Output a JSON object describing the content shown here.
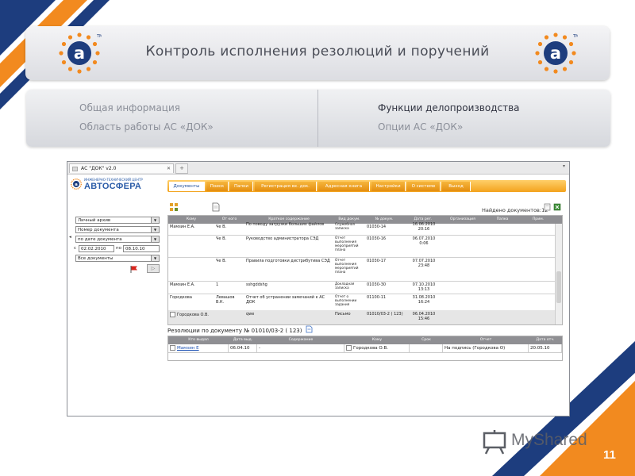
{
  "slide": {
    "title": "Контроль исполнения резолюций и поручений",
    "page_number": "11",
    "colors": {
      "orange": "#f28a1f",
      "navy": "#1d3d7e",
      "accent_blue": "#2b5ca8"
    }
  },
  "info_panel": {
    "left": [
      "Общая информация",
      "Область работы АС «ДОК»"
    ],
    "right": [
      "Функции делопроизводства",
      "Опции АС «ДОК»"
    ]
  },
  "browser": {
    "tab_title": "АС \"ДОК\" v2.0",
    "tab_close": "✕",
    "new_tab": "+",
    "scroll_arrow": "▾"
  },
  "app": {
    "brand_small": "ИНЖЕНЕРНО-ТЕХНИЧЕСКИЙ ЦЕНТР",
    "brand_big": "АВТОСФЕРА",
    "nav": [
      "Документы",
      "Поиск",
      "Папки",
      "Регистрация вх. док.",
      "Адресная книга",
      "Настройки",
      "О системе",
      "Выход"
    ],
    "found_label": "Найдено документов:",
    "found_count": "12",
    "sidebar": {
      "archive": "Личный архив",
      "field": "Номер документа",
      "sort": "по дате документа",
      "from_label": "с",
      "from_date": "02.02.2010",
      "to_label": "по",
      "to_date": "08.10.10",
      "doc_filter": "Все документы",
      "go_button": "▷"
    },
    "grid": {
      "headers": [
        "Кому",
        "От кого",
        "Краткое содержание",
        "Вид докум.",
        "№ докум.",
        "Дата рег.",
        "Организация",
        "Папка",
        "Прим."
      ],
      "rows": [
        {
          "to": "Мамзин Е.А.",
          "from": "Че В.",
          "summary": "По поводу загрузки больших файлов",
          "type": "Служебная записка",
          "num": "01030-14",
          "date": "16.06.2010",
          "time": "20:16"
        },
        {
          "to": "",
          "from": "Че В.",
          "summary": "Руководство администратора СЭД",
          "type": "Отчет выполнения мероприятий плана",
          "num": "01030-16",
          "date": "06.07.2010",
          "time": "0:06"
        },
        {
          "to": "",
          "from": "Че В.",
          "summary": "Правила подготовки дистрибутива СЭД",
          "type": "Отчет выполнения мероприятий плана",
          "num": "01030-17",
          "date": "07.07.2010",
          "time": "23:48"
        },
        {
          "to": "Мамзин Е.А.",
          "from": "1",
          "summary": "sshgddshg",
          "type": "Докладная записка",
          "num": "01030-30",
          "date": "07.10.2010",
          "time": "13:13"
        },
        {
          "to": "Городкова",
          "from": "Левашов В.К.",
          "summary": "Отчет об устранении замечаний к АС ДОК",
          "type": "Отчет о выполнении задания",
          "num": "01100-11",
          "date": "31.08.2010",
          "time": "16:24"
        },
        {
          "to": "Городкова О.В.",
          "from": "",
          "summary": "qwe",
          "type": "Письмо",
          "num": "01010/03-2 ( 123)",
          "date": "06.04.2010",
          "time": "15:46"
        }
      ]
    },
    "resolutions": {
      "title": "Резолюции по документу № 01010/03-2 ( 123)",
      "headers": [
        "Кто выдал",
        "Дата выд.",
        "Содержание",
        "Кому",
        "Срок",
        "Отчет",
        "Дата отч."
      ],
      "row": {
        "author": "Мамзин Е",
        "date": "06.04.10",
        "content": "-",
        "to": "Городкова О.В.",
        "deadline": "",
        "report": "На подпись (Городкова О)",
        "report_date": "20.05.10"
      }
    }
  },
  "watermark": {
    "text": "MyShared"
  }
}
